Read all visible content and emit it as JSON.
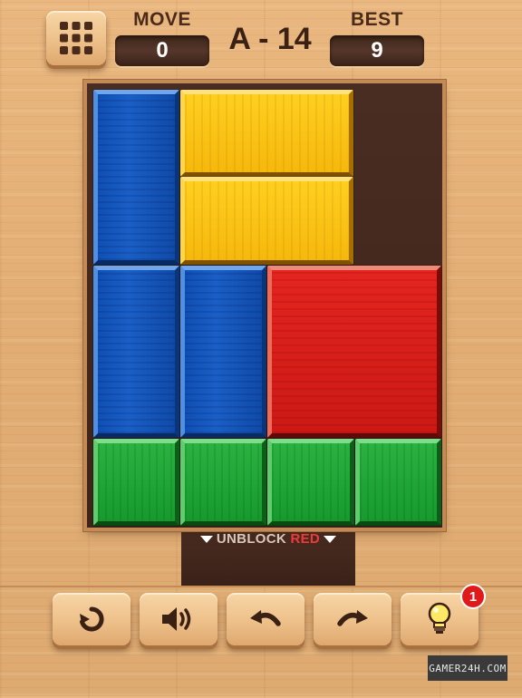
{
  "header": {
    "menu_icon": "grid-menu-icon",
    "move_label": "MOVE",
    "move_value": "0",
    "level": "A - 14",
    "best_label": "BEST",
    "best_value": "9"
  },
  "board": {
    "colors": {
      "blue": "#1a5fc6",
      "yellow": "#f6b80c",
      "red": "#d41c17",
      "green": "#1fa636",
      "board_bg": "#4a2d22"
    },
    "blocks": [
      {
        "color": "blue",
        "name": "blue-block-1"
      },
      {
        "color": "yellow",
        "name": "yellow-block-1"
      },
      {
        "color": "yellow",
        "name": "yellow-block-2"
      },
      {
        "color": "blue",
        "name": "blue-block-2"
      },
      {
        "color": "blue",
        "name": "blue-block-3"
      },
      {
        "color": "red",
        "name": "red-block"
      },
      {
        "color": "green",
        "name": "green-block-1"
      },
      {
        "color": "green",
        "name": "green-block-2"
      },
      {
        "color": "green",
        "name": "green-block-3"
      },
      {
        "color": "green",
        "name": "green-block-4"
      }
    ]
  },
  "exit": {
    "hint_prefix": "UNBLOCK",
    "hint_highlight": "RED"
  },
  "toolbar": {
    "buttons": [
      {
        "icon": "restart-icon"
      },
      {
        "icon": "sound-icon"
      },
      {
        "icon": "undo-icon"
      },
      {
        "icon": "redo-icon"
      },
      {
        "icon": "hint-lightbulb-icon",
        "badge": "1"
      }
    ]
  },
  "watermark": "GAMER24H.COM"
}
